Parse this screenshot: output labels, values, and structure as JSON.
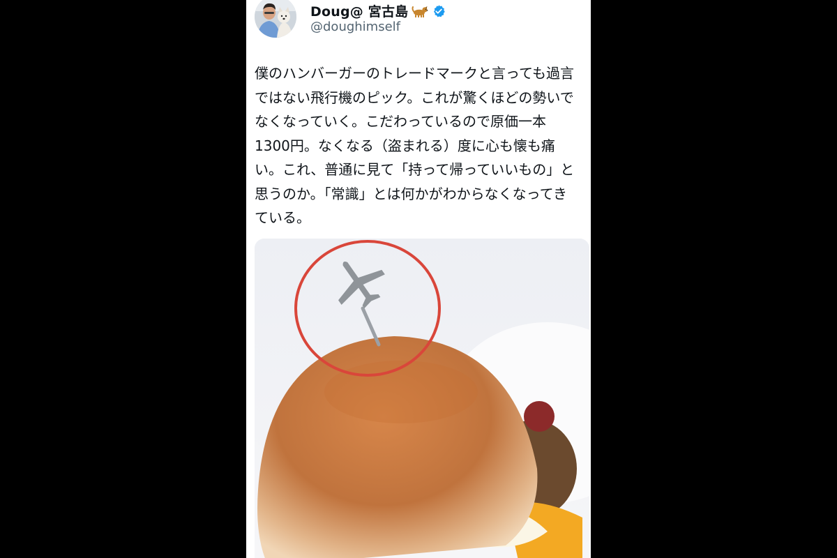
{
  "tweet": {
    "author": {
      "display_name": "Doug@ 宮古島",
      "handle": "@doughimself",
      "verified": true,
      "name_emoji": "dog-emoji-icon"
    },
    "text": "僕のハンバーガーのトレードマークと言っても過言\nではない飛行機のピック。これが驚くほどの勢いで\nなくなっていく。こだわっているので原価一本\n1300円。なくなる（盗まれる）度に心も懐も痛\nい。これ、普通に見て「持って帰っていいもの」と\n思うのか。「常識」とは何かがわからなくなってき\nている。",
    "media": {
      "kind": "photo",
      "subject": "hamburger-with-airplane-pick",
      "highlight_color": "#d9463a"
    }
  },
  "colors": {
    "page_background": "#000000",
    "card_background": "#ffffff",
    "text_primary": "#0f1419",
    "text_secondary": "#536471",
    "verified_blue": "#1d9bf0"
  }
}
